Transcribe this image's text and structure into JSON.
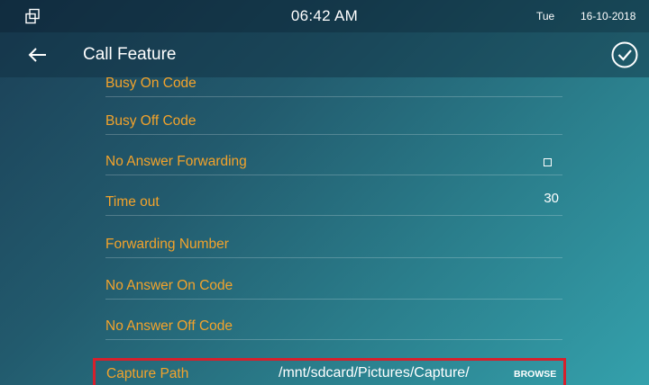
{
  "status_bar": {
    "icon": "window-restore-icon",
    "time": "06:42 AM",
    "day": "Tue",
    "date": "16-10-2018"
  },
  "header": {
    "back_icon": "arrow-left-icon",
    "title": "Call Feature",
    "confirm_icon": "check-circle-icon"
  },
  "settings": {
    "busy_on_code": {
      "label": "Busy On Code"
    },
    "busy_off_code": {
      "label": "Busy Off Code"
    },
    "no_answer_forwarding": {
      "label": "No Answer Forwarding",
      "checked": false
    },
    "time_out": {
      "label": "Time out",
      "value": "30"
    },
    "forwarding_number": {
      "label": "Forwarding Number"
    },
    "no_answer_on_code": {
      "label": "No Answer On Code"
    },
    "no_answer_off_code": {
      "label": "No Answer Off Code"
    },
    "capture_path": {
      "label": "Capture Path",
      "value": "/mnt/sdcard/Pictures/Capture/",
      "browse_label": "BROWSE"
    }
  },
  "colors": {
    "label": "#f3a32b",
    "highlight_border": "#d6202c",
    "text": "#ffffff"
  }
}
